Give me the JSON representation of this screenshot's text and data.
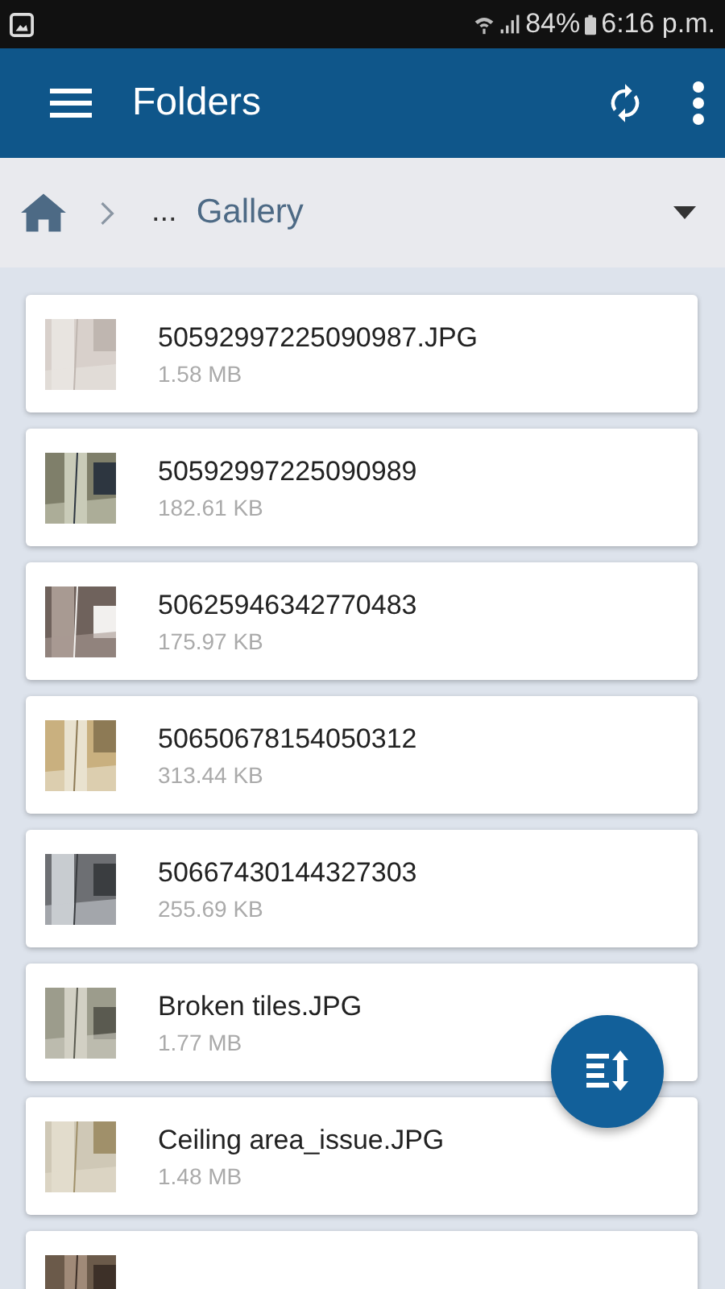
{
  "status_bar": {
    "battery": "84%",
    "time": "6:16 p.m."
  },
  "app_bar": {
    "title": "Folders"
  },
  "breadcrumb": {
    "ellipsis": "...",
    "current": "Gallery"
  },
  "files": [
    {
      "kind": "picture",
      "name": "50592997225090987.JPG",
      "size": "1.58 MB"
    },
    {
      "kind": "picture",
      "name": "50592997225090989",
      "size": "182.61 KB"
    },
    {
      "kind": "picture",
      "name": "50625946342770483",
      "size": "175.97 KB"
    },
    {
      "kind": "picture",
      "name": "50650678154050312",
      "size": "313.44 KB"
    },
    {
      "kind": "picture",
      "name": "50667430144327303",
      "size": "255.69 KB"
    },
    {
      "kind": "picture",
      "name": "Broken tiles.JPG",
      "size": "1.77 MB"
    },
    {
      "kind": "picture",
      "name": "Ceiling area_issue.JPG",
      "size": "1.48 MB"
    },
    {
      "kind": "picture"
    }
  ]
}
